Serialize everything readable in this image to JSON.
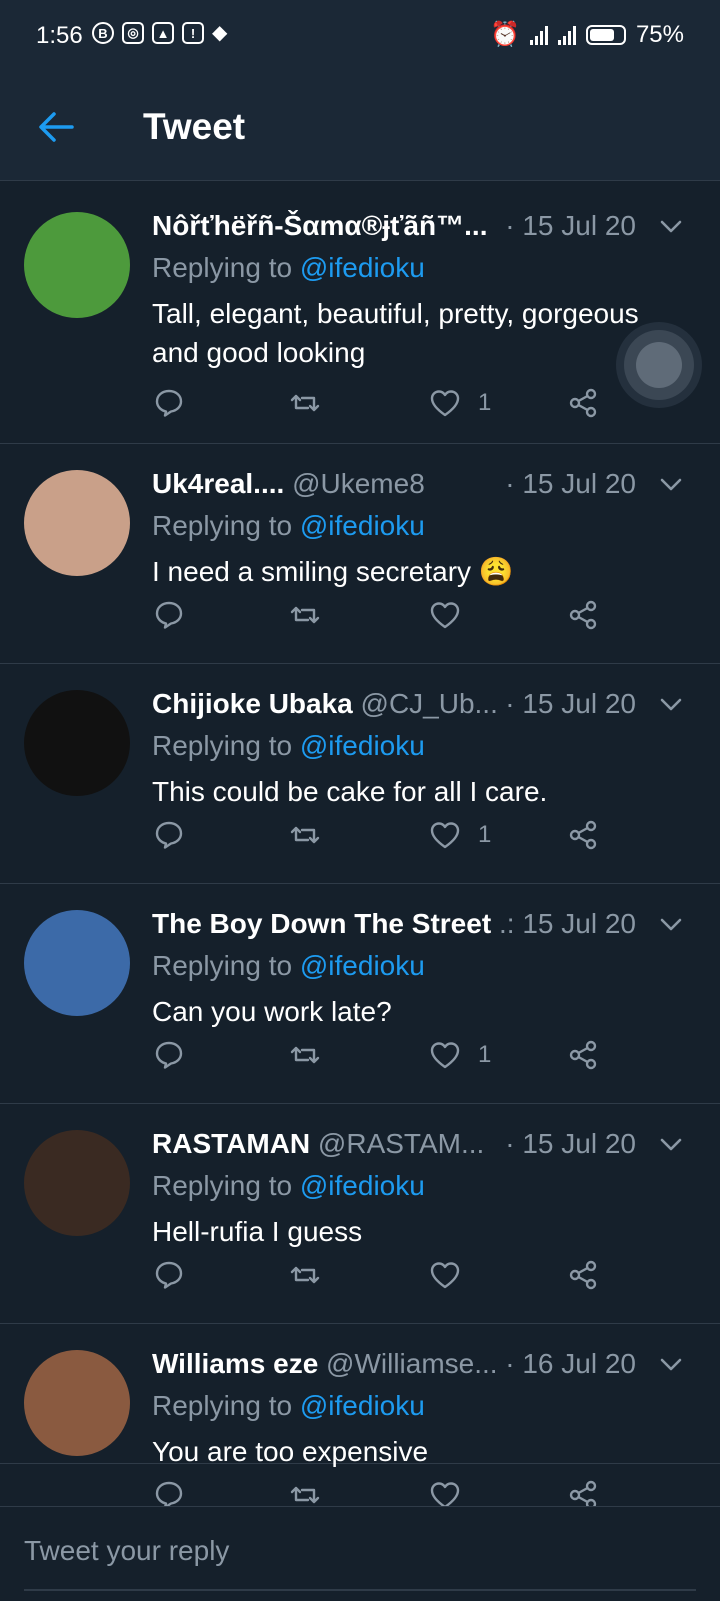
{
  "status_bar": {
    "time": "1:56",
    "battery": "75%"
  },
  "header": {
    "title": "Tweet"
  },
  "tweets": [
    {
      "name": "Nôřťhëřñ-Šαmα®ɉťãñ™...",
      "handle": "",
      "date": "· 15 Jul 20",
      "replying_prefix": "Replying to ",
      "replying_to": "@ifedioku",
      "text": "Tall, elegant, beautiful, pretty, gorgeous and good looking",
      "like_count": "1",
      "avatar_color": "#4d9a3c"
    },
    {
      "name": "Uk4real....",
      "handle": "@Ukeme8",
      "date": "· 15 Jul 20",
      "replying_prefix": "Replying to ",
      "replying_to": "@ifedioku",
      "text": "I need a smiling secretary 😩",
      "like_count": "",
      "avatar_color": "#c9a089"
    },
    {
      "name": "Chijioke Ubaka",
      "handle": "@CJ_Ub...",
      "date": "· 15 Jul 20",
      "replying_prefix": "Replying to ",
      "replying_to": "@ifedioku",
      "text": "This could be cake for all I care.",
      "like_count": "1",
      "avatar_color": "#111111"
    },
    {
      "name": "The Boy Down The Street",
      "handle": "",
      "date": ".: 15 Jul 20",
      "replying_prefix": "Replying to ",
      "replying_to": "@ifedioku",
      "text": "Can you work late?",
      "like_count": "1",
      "avatar_color": "#3c6aa8"
    },
    {
      "name": "RASTAMAN",
      "handle": "@RASTAM...",
      "date": "· 15 Jul 20",
      "replying_prefix": "Replying to ",
      "replying_to": "@ifedioku",
      "text": "Hell-rufia I guess",
      "like_count": "",
      "avatar_color": "#3a2a22"
    },
    {
      "name": "Williams eze",
      "handle": "@Williamse...",
      "date": "· 16 Jul 20",
      "replying_prefix": "Replying to ",
      "replying_to": "@ifedioku",
      "text": "You are too expensive",
      "like_count": "",
      "avatar_color": "#8a5a40"
    }
  ],
  "composer": {
    "placeholder": "Tweet your reply"
  },
  "colors": {
    "background": "#15202b",
    "accent": "#1d9bf0",
    "muted": "#8b98a5"
  }
}
